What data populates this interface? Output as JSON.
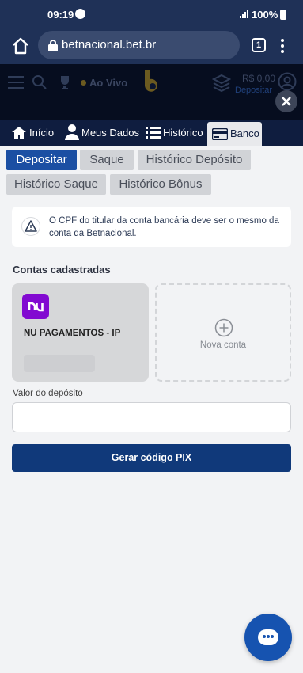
{
  "status_bar": {
    "time": "09:19",
    "battery": "100%"
  },
  "browser": {
    "url": "betnacional.bet.br",
    "tab_count": "1"
  },
  "site_header": {
    "live_label": "Ao Vivo",
    "balance": "R$ 0,00",
    "deposit_link": "Depositar"
  },
  "nav_tabs": [
    {
      "label": "Início",
      "icon": "home-icon"
    },
    {
      "label": "Meus Dados",
      "icon": "user-icon"
    },
    {
      "label": "Histórico",
      "icon": "list-icon"
    },
    {
      "label": "Banco",
      "icon": "card-icon"
    }
  ],
  "sub_tabs": [
    "Depositar",
    "Saque",
    "Histórico Depósito",
    "Histórico Saque",
    "Histórico Bônus"
  ],
  "notice": "O CPF do titular da conta bancária deve ser o mesmo da conta da Betnacional.",
  "accounts_section": {
    "title": "Contas cadastradas",
    "accounts": [
      {
        "logo_text": "nu",
        "name": "NU PAGAMENTOS - IP"
      }
    ],
    "new_account_label": "Nova conta"
  },
  "deposit": {
    "label": "Valor do depósito",
    "value": "",
    "button": "Gerar código PIX"
  },
  "colors": {
    "primary": "#1b4fa3",
    "nav_bg": "#0f1d3f",
    "button": "#10397a",
    "nubank": "#820ad1"
  }
}
